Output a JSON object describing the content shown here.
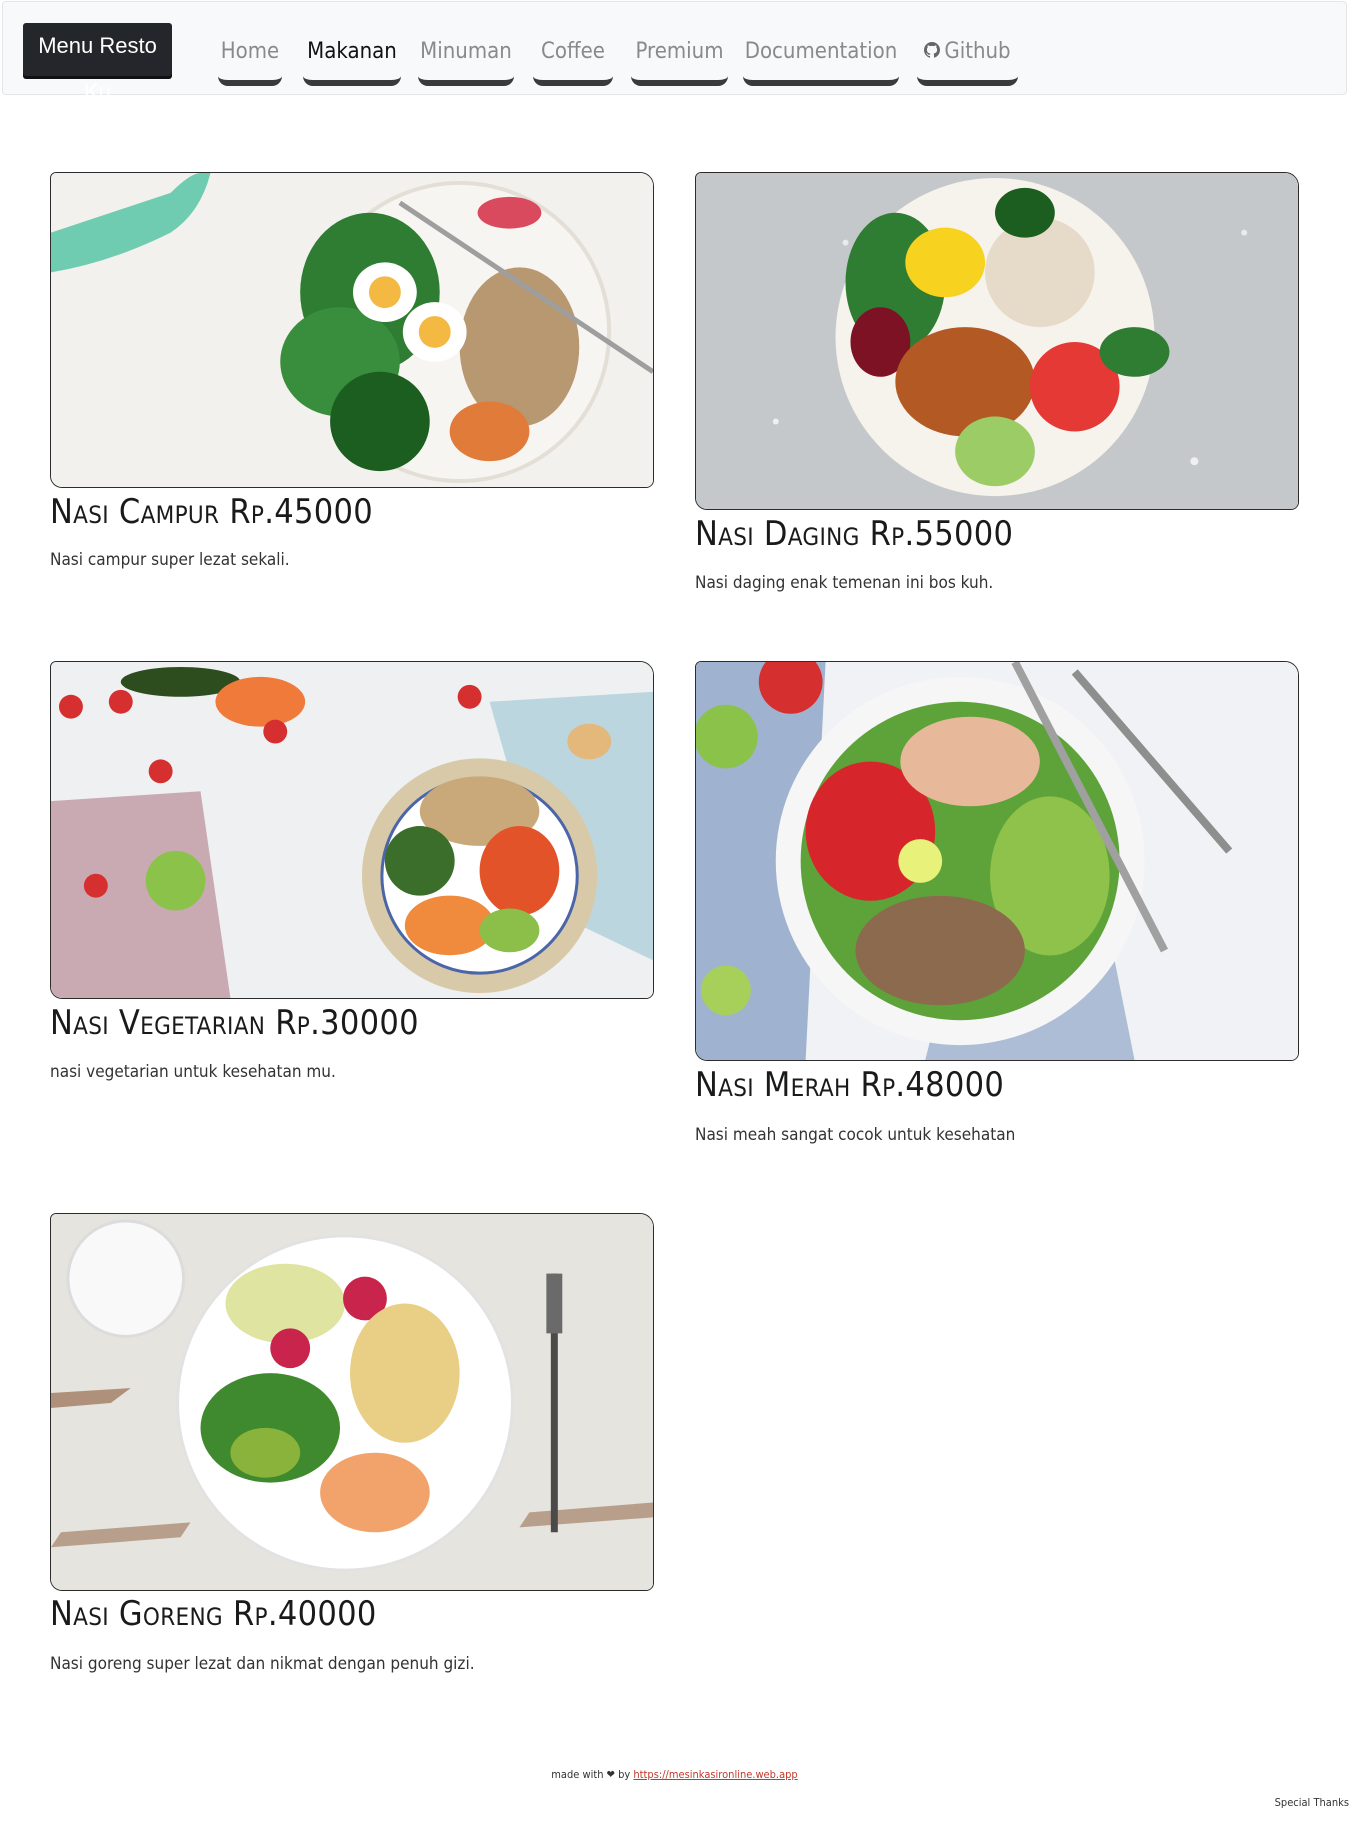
{
  "navbar": {
    "brand": "Menu Resto Ku",
    "items": [
      {
        "label": "Home",
        "active": false
      },
      {
        "label": "Makanan",
        "active": true
      },
      {
        "label": "Minuman",
        "active": false
      },
      {
        "label": "Coffee",
        "active": false
      },
      {
        "label": "Premium",
        "active": false
      },
      {
        "label": "Documentation",
        "active": false
      },
      {
        "label": "Github",
        "active": false,
        "icon": "github-icon"
      }
    ]
  },
  "menu": [
    {
      "title": "Nasi Campur Rp.45000",
      "description": "Nasi campur super lezat sekali.",
      "image": "salad-bowl-eggs-photo"
    },
    {
      "title": "Nasi Daging Rp.55000",
      "description": "Nasi daging enak temenan ini bos kuh.",
      "image": "chicken-rice-bowl-photo"
    },
    {
      "title": "Nasi Vegetarian Rp.30000",
      "description": "nasi vegetarian untuk kesehatan mu.",
      "image": "vegetable-quinoa-bowl-photo"
    },
    {
      "title": "Nasi Merah Rp.48000",
      "description": "Nasi meah sangat cocok untuk kesehatan",
      "image": "quinoa-avocado-bowl-photo"
    },
    {
      "title": "Nasi Goreng Rp.40000",
      "description": "Nasi goreng super lezat dan nikmat dengan penuh gizi.",
      "image": "shrimp-plate-photo"
    }
  ],
  "footer": {
    "made_with": "made with",
    "heart": "❤",
    "by": "by",
    "link_text": "https://mesinkasironline.web.app",
    "special_thanks": "Special Thanks"
  },
  "colors": {
    "brand_bg": "#23272b",
    "navbar_bg": "#f8f9fa",
    "link": "#c0392b"
  }
}
